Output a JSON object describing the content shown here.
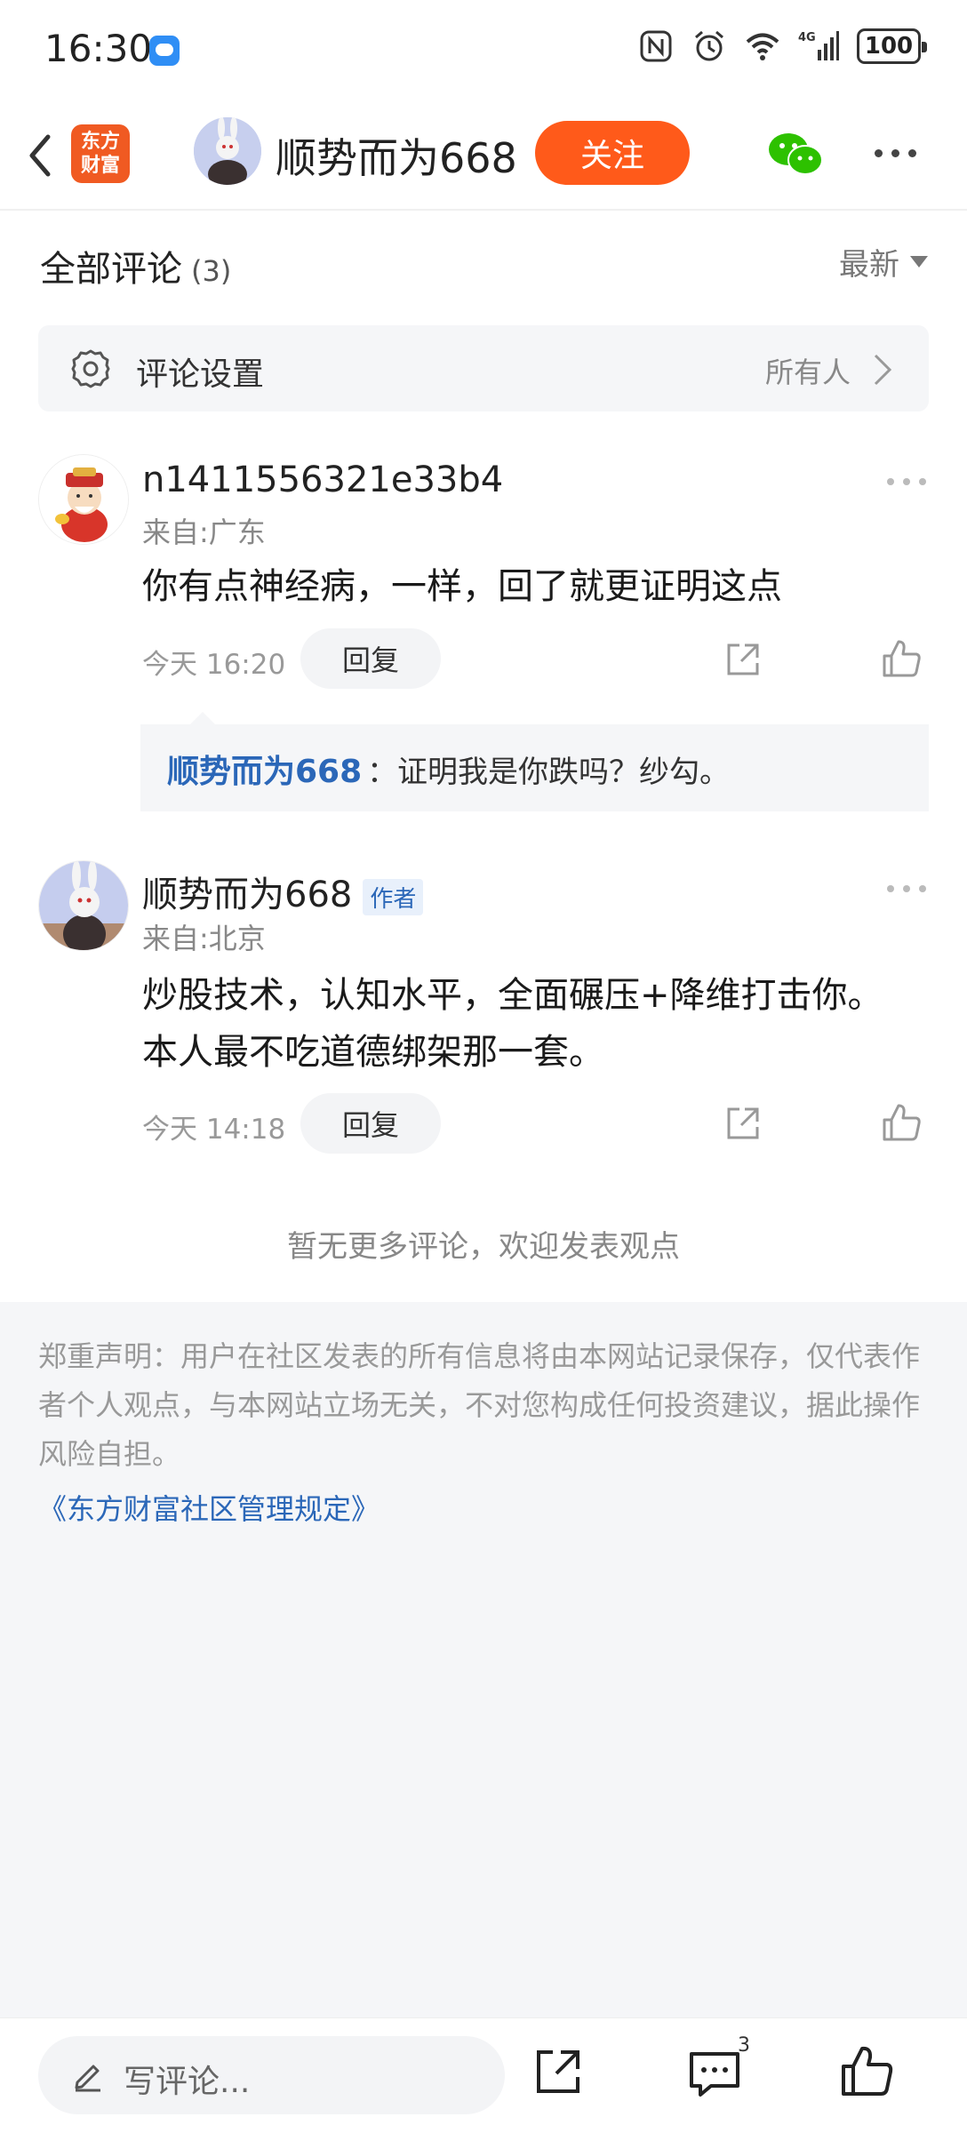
{
  "status_bar": {
    "time": "16:30",
    "network_label": "4G",
    "battery": "100"
  },
  "header": {
    "app_logo_line1": "东方",
    "app_logo_line2": "财富",
    "username": "顺势而为668",
    "follow_label": "关注"
  },
  "comments_header": {
    "title": "全部评论",
    "count": "(3)",
    "sort_label": "最新"
  },
  "settings": {
    "label": "评论设置",
    "value": "所有人"
  },
  "comments": [
    {
      "name": "n1411556321e33b4",
      "location": "来自:广东",
      "text": "你有点神经病，一样，回了就更证明这点",
      "time": "今天 16:20",
      "reply_label": "回复",
      "reply": {
        "author": "顺势而为668",
        "text": "：证明我是你跌吗？纱勾。"
      }
    },
    {
      "name": "顺势而为668",
      "badge": "作者",
      "location": "来自:北京",
      "text_line1": "炒股技术，认知水平，全面碾压+降维打击你。",
      "text_line2": "本人最不吃道德绑架那一套。",
      "time": "今天 14:18",
      "reply_label": "回复"
    }
  ],
  "no_more": "暂无更多评论，欢迎发表观点",
  "disclaimer": {
    "text": "郑重声明：用户在社区发表的所有信息将由本网站记录保存，仅代表作者个人观点，与本网站立场无关，不对您构成任何投资建议，据此操作风险自担。",
    "link": "《东方财富社区管理规定》"
  },
  "bottom_bar": {
    "placeholder": "写评论...",
    "comment_count": "3"
  },
  "colors": {
    "accent": "#ff5a1a",
    "link": "#2b67b8"
  }
}
